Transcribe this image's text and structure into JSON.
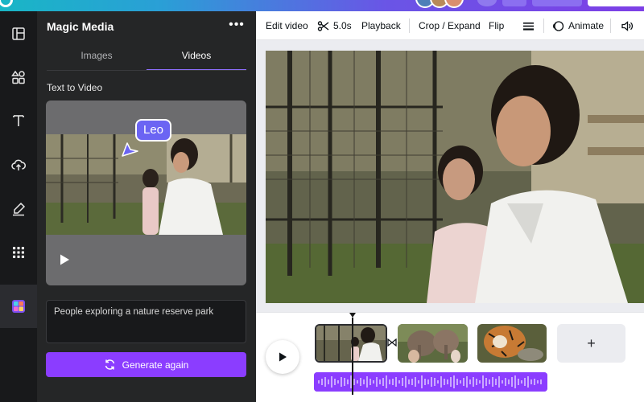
{
  "panel": {
    "title": "Magic Media",
    "more_label": "•••",
    "tabs": [
      {
        "label": "Images",
        "active": false
      },
      {
        "label": "Videos",
        "active": true
      }
    ],
    "section_label": "Text to Video",
    "collaborator_tag": "Leo",
    "prompt_text": "People exploring a nature reserve park",
    "generate_label": "Generate again"
  },
  "rail": {
    "items": [
      "design-icon",
      "elements-icon",
      "text-icon",
      "uploads-icon",
      "draw-icon",
      "apps-icon",
      "magic-media-icon"
    ]
  },
  "toolbar": {
    "edit_video": "Edit video",
    "duration": "5.0s",
    "playback": "Playback",
    "crop_expand": "Crop / Expand",
    "flip": "Flip",
    "animate": "Animate"
  },
  "timeline": {
    "add_label": "+",
    "clips": [
      "clip-girl-woman",
      "clip-elephants",
      "clip-tiger"
    ]
  },
  "colors": {
    "accent": "#8b3dff",
    "tab_underline": "#8b6cf6",
    "collaborator": "#6b64f3",
    "panel_bg": "#252627",
    "rail_bg": "#18191b",
    "canvas_bg": "#ebecf0"
  }
}
